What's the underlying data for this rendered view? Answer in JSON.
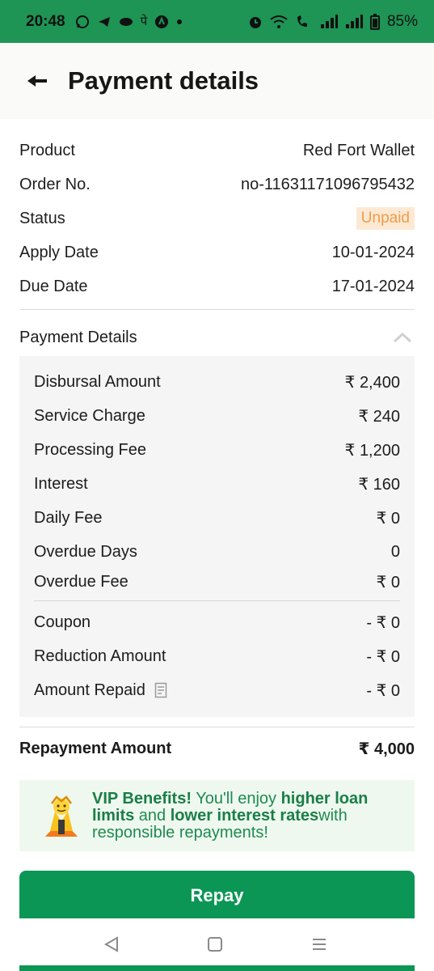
{
  "status_bar": {
    "time": "20:48",
    "battery": "85%",
    "icons_left": [
      "whatsapp-icon",
      "telegram-icon",
      "gamepad-icon",
      "phonepe-icon",
      "app-icon",
      "dot-icon"
    ],
    "icons_right": [
      "alarm-icon",
      "wifi-icon",
      "volte-icon",
      "signal-icon",
      "signal-icon",
      "battery-icon"
    ]
  },
  "header": {
    "title": "Payment details"
  },
  "summary": {
    "product_label": "Product",
    "product_value": "Red Fort Wallet",
    "order_label": "Order No.",
    "order_value": "no-11631171096795432",
    "status_label": "Status",
    "status_value": "Unpaid",
    "apply_label": "Apply Date",
    "apply_value": "10-01-2024",
    "due_label": "Due Date",
    "due_value": "17-01-2024"
  },
  "payment_details": {
    "title": "Payment Details",
    "rows": [
      {
        "label": "Disbursal Amount",
        "value": "₹ 2,400"
      },
      {
        "label": "Service Charge",
        "value": "₹ 240"
      },
      {
        "label": "Processing Fee",
        "value": "₹ 1,200"
      },
      {
        "label": "Interest",
        "value": "₹ 160"
      },
      {
        "label": "Daily Fee",
        "value": "₹ 0"
      },
      {
        "label": "Overdue Days",
        "value": "0"
      },
      {
        "label": "Overdue Fee",
        "value": "₹ 0"
      }
    ],
    "deductions": [
      {
        "label": "Coupon",
        "value": "- ₹ 0"
      },
      {
        "label": "Reduction Amount",
        "value": "- ₹ 0"
      },
      {
        "label": "Amount Repaid",
        "value": "- ₹ 0"
      }
    ]
  },
  "repayment": {
    "label": "Repayment Amount",
    "value": "₹ 4,000"
  },
  "vip": {
    "t1": "VIP Benefits!",
    "t2": " You'll enjoy ",
    "t3": "higher loan limits",
    "t4": " and ",
    "t5": "lower interest rates",
    "t6": "with responsible repayments!"
  },
  "actions": {
    "repay_label": "Repay"
  },
  "colors": {
    "brand_green": "#0b9655",
    "status_bar_green": "#1e9455",
    "unpaid_text": "#ee9c4a",
    "unpaid_bg": "#fde9d3"
  }
}
